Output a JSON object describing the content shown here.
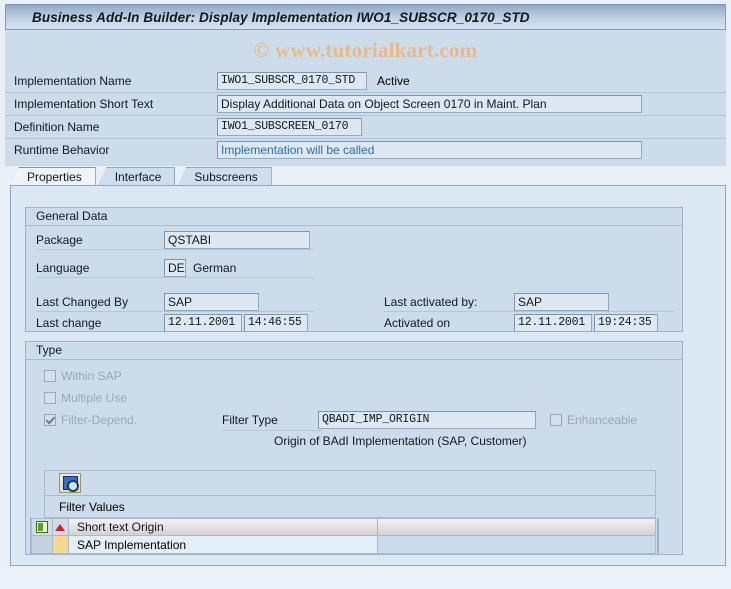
{
  "window": {
    "title": "Business Add-In Builder: Display Implementation IWO1_SUBSCR_0170_STD"
  },
  "watermark": {
    "text": "© www.tutorialkart.com",
    "color": "#e9b98a"
  },
  "header_form": {
    "rows": [
      {
        "label": "Implementation Name",
        "value": "IWO1_SUBSCR_0170_STD",
        "status": "Active"
      },
      {
        "label": "Implementation Short Text",
        "value": "Display Additional Data on Object Screen 0170 in Maint. Plan"
      },
      {
        "label": "Definition Name",
        "value": "IWO1_SUBSCREEN_0170"
      },
      {
        "label": "Runtime Behavior",
        "value": "Implementation will be called"
      }
    ]
  },
  "tabs": [
    {
      "label": "Properties",
      "selected": true
    },
    {
      "label": "Interface",
      "selected": false
    },
    {
      "label": "Subscreens",
      "selected": false
    }
  ],
  "general_data": {
    "title": "General Data",
    "package": {
      "label": "Package",
      "value": "QSTABI"
    },
    "language": {
      "label": "Language",
      "code": "DE",
      "name": "German"
    },
    "last_changed_by": {
      "label": "Last Changed By",
      "value": "SAP"
    },
    "last_change": {
      "label": "Last change",
      "date": "12.11.2001",
      "time": "14:46:55"
    },
    "last_activated_by": {
      "label": "Last activated by:",
      "value": "SAP"
    },
    "activated_on": {
      "label": "Activated on",
      "date": "12.11.2001",
      "time": "19:24:35"
    }
  },
  "type_section": {
    "title": "Type",
    "checkboxes": [
      {
        "label": "Within SAP",
        "checked": false,
        "disabled": true
      },
      {
        "label": "Multiple Use",
        "checked": false,
        "disabled": true
      },
      {
        "label": "Filter-Depend.",
        "checked": true,
        "disabled": true
      }
    ],
    "enhanceable": {
      "label": "Enhanceable",
      "checked": false,
      "disabled": true
    },
    "filter_type": {
      "label": "Filter Type",
      "value": "QBADI_IMP_ORIGIN"
    },
    "filter_type_description": "Origin of BAdI Implementation (SAP, Customer)",
    "toolbar": {
      "display_icon": "magnifier-detail-icon"
    },
    "filter_values": {
      "caption": "Filter Values",
      "columns": [
        "Short text Origin",
        ""
      ],
      "rows": [
        {
          "cells": [
            "SAP Implementation",
            ""
          ]
        }
      ]
    }
  }
}
